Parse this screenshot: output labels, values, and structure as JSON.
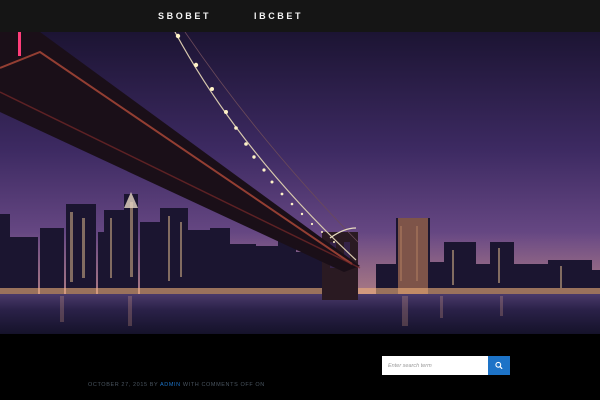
{
  "nav": {
    "items": [
      {
        "label": "SBOBET"
      },
      {
        "label": "IBCBET"
      }
    ]
  },
  "hero": {
    "colors": {
      "sky_top": "#1c1433",
      "sky_mid": "#3d2a62",
      "sky_low": "#6a4a86",
      "water": "#2a2148",
      "bridge": "#1a0f18",
      "lights": "#fff3c8"
    }
  },
  "search": {
    "placeholder": "Enter search term",
    "value": "",
    "icon": "search-icon",
    "button_color": "#1d73c7"
  },
  "post_meta": {
    "date": "OCTOBER 27, 2015",
    "by": " BY ",
    "author": "ADMIN",
    "comments": " WITH COMMENTS OFF ON"
  }
}
